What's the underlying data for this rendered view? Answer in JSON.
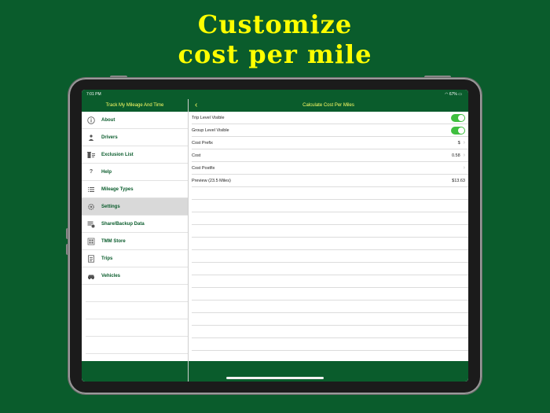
{
  "headline": {
    "line1": "Customize",
    "line2": "cost per mile"
  },
  "status_bar": {
    "time": "7:01 PM",
    "battery": "67%"
  },
  "sidebar": {
    "title": "Track My Mileage And Time",
    "items": [
      {
        "label": "About",
        "icon": "info-icon"
      },
      {
        "label": "Drivers",
        "icon": "driver-icon"
      },
      {
        "label": "Exclusion List",
        "icon": "exclusion-list-icon"
      },
      {
        "label": "Help",
        "icon": "help-icon"
      },
      {
        "label": "Mileage Types",
        "icon": "list-icon"
      },
      {
        "label": "Settings",
        "icon": "gear-icon",
        "selected": true
      },
      {
        "label": "Share/Backup Data",
        "icon": "share-backup-icon"
      },
      {
        "label": "TMM Store",
        "icon": "store-icon"
      },
      {
        "label": "Trips",
        "icon": "trips-icon"
      },
      {
        "label": "Vehicles",
        "icon": "car-icon"
      }
    ]
  },
  "detail": {
    "title": "Calculate Cost Per Miles",
    "rows": [
      {
        "label": "Trip Level Visible",
        "toggle": true
      },
      {
        "label": "Group Level Visible",
        "toggle": true
      },
      {
        "label": "Cost Prefix",
        "value": "$"
      },
      {
        "label": "Cost",
        "value": "0.58"
      },
      {
        "label": "Cost Postfix",
        "value": ""
      },
      {
        "label": "Preview (23.5 Miles)",
        "value": "$13.63"
      }
    ]
  },
  "colors": {
    "brand_green": "#0a5c2c",
    "headline_yellow": "#ffff00",
    "toggle_on": "#3fbf3f"
  }
}
